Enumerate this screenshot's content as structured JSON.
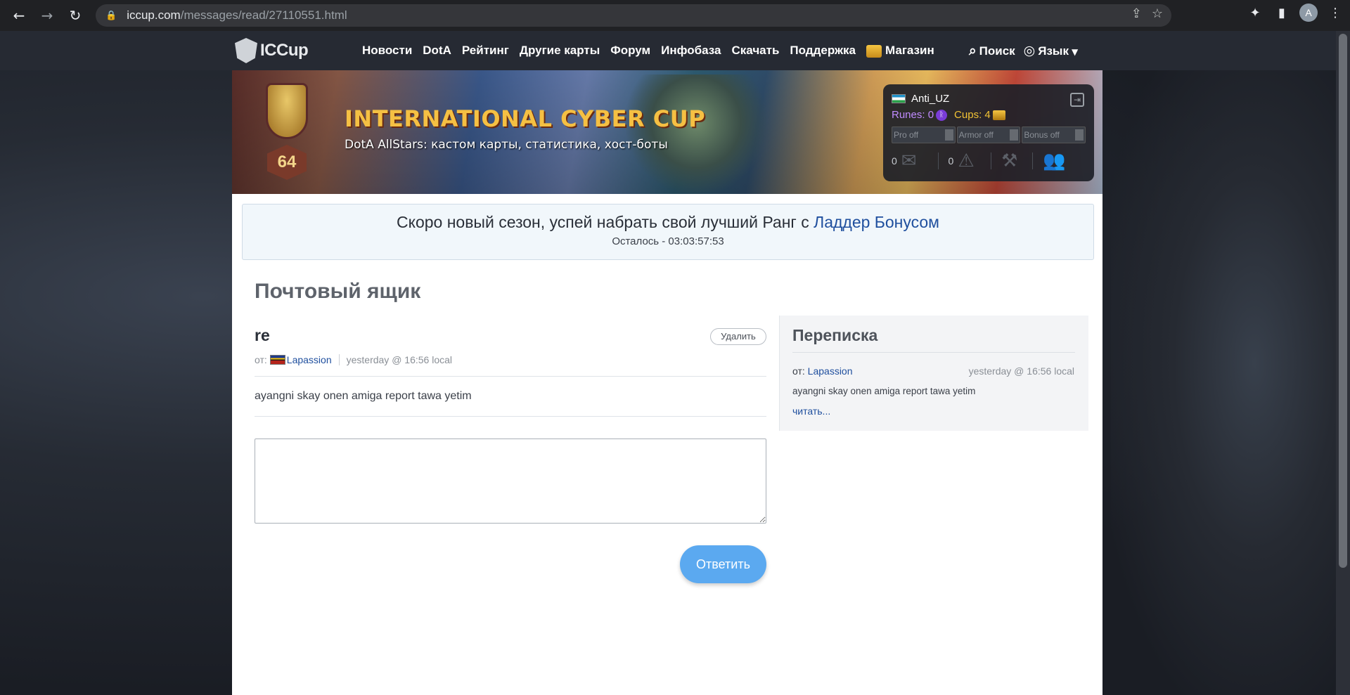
{
  "browser": {
    "url_host": "iccup.com",
    "url_path": "/messages/read/27110551.html",
    "avatar_letter": "A"
  },
  "nav": {
    "logo": "ICCup",
    "items": [
      "Новости",
      "DotA",
      "Рейтинг",
      "Другие карты",
      "Форум",
      "Инфобаза",
      "Скачать",
      "Поддержка",
      "Магазин"
    ],
    "search": "Поиск",
    "language": "Язык"
  },
  "banner": {
    "title": "INTERNATIONAL CYBER CUP",
    "subtitle": "DotA AllStars: кастом карты, статистика, хост-боты",
    "badge_number": "64"
  },
  "user_panel": {
    "username": "Anti_UZ",
    "runes_label": "Runes: 0",
    "cups_label": "Cups: 4",
    "toggles": [
      "Pro off",
      "Armor off",
      "Bonus off"
    ],
    "messages_count": "0",
    "warnings_count": "0"
  },
  "season": {
    "text": "Скоро новый сезон, успей набрать свой лучший Ранг с",
    "link": "Ладдер Бонусом",
    "timer": "Осталось - 03:03:57:53"
  },
  "mailbox": {
    "title": "Почтовый ящик",
    "message": {
      "title": "re",
      "delete_label": "Удалить",
      "from_label": "от:",
      "from_user": "Lapassion",
      "time": "yesterday @ 16:56 local",
      "body": "ayangni skay onen amiga report tawa yetim"
    },
    "reply_label": "Ответить"
  },
  "correspondence": {
    "title": "Переписка",
    "from_label": "от:",
    "from_user": "Lapassion",
    "time": "yesterday @ 16:56 local",
    "body": "ayangni skay onen amiga report tawa yetim",
    "read_more": "читать..."
  },
  "colors": {
    "accent_link": "#1f4f9e",
    "reply_button": "#5ba9f0",
    "banner_title": "#f5c043"
  }
}
